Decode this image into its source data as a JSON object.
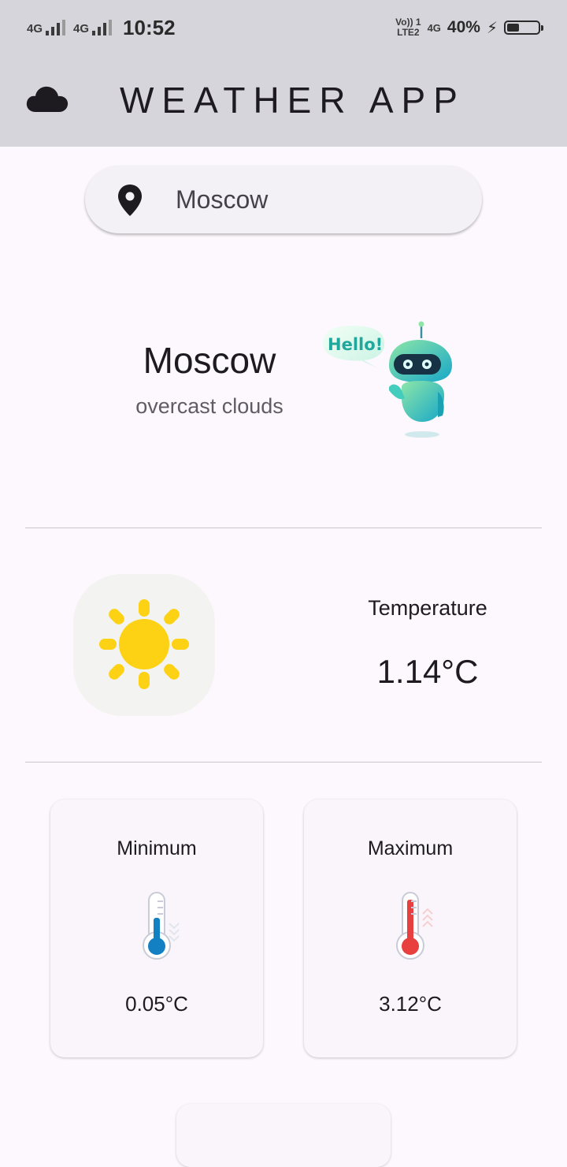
{
  "status_bar": {
    "sim1_label": "4G",
    "sim2_label": "4G",
    "time": "10:52",
    "volte_line1": "Vo)) 1",
    "volte_line2": "LTE2",
    "network_label": "4G",
    "battery_percent": "40%",
    "battery_level": 0.4
  },
  "app_bar": {
    "title": "WEATHER APP",
    "icon": "cloud-icon"
  },
  "search": {
    "icon": "location-pin-icon",
    "value": "Moscow"
  },
  "current": {
    "city": "Moscow",
    "description": "overcast clouds",
    "mascot_greeting": "Hello!"
  },
  "temperature": {
    "icon": "sun-icon",
    "label": "Temperature",
    "value": "1.14°C"
  },
  "min_card": {
    "label": "Minimum",
    "icon": "thermometer-cold-icon",
    "value": "0.05°C"
  },
  "max_card": {
    "label": "Maximum",
    "icon": "thermometer-hot-icon",
    "value": "3.12°C"
  },
  "colors": {
    "app_bar_bg": "#d6d5db",
    "page_bg": "#fdf8fd",
    "sun": "#fdd114",
    "cold": "#1480c4",
    "hot": "#e8403f",
    "robot": "#3ccfc4"
  }
}
